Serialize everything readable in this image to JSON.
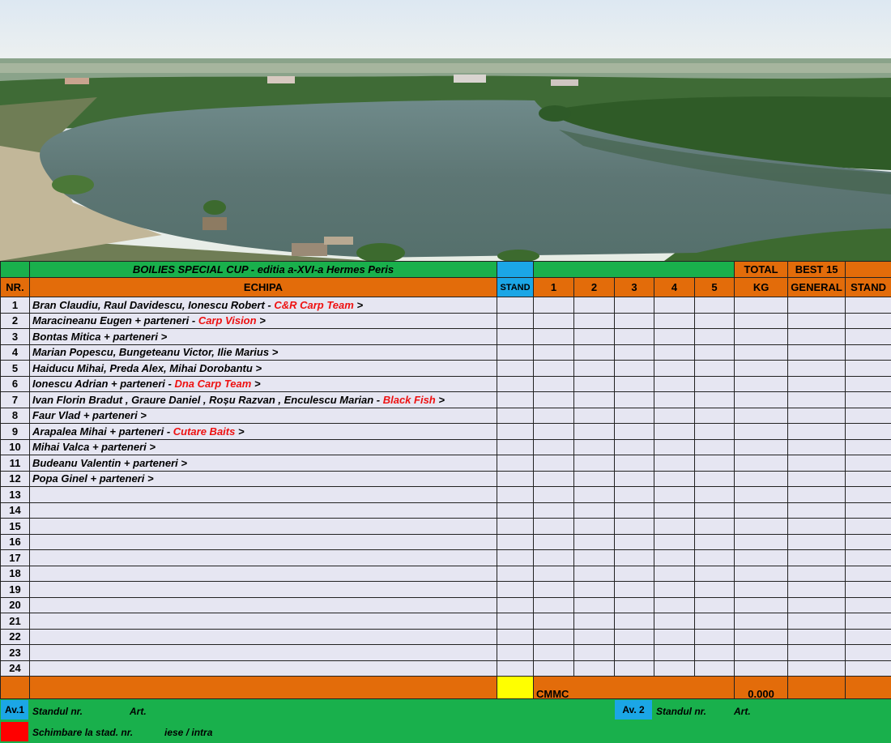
{
  "header": {
    "title": "BOILIES SPECIAL CUP - editia a-XVI-a Hermes Peris",
    "total_label": "TOTAL",
    "kg_label": "KG",
    "best_label": "BEST 15",
    "general_label": "GENERAL",
    "stand_label": "STAND",
    "nr_label": "NR.",
    "echipa_label": "ECHIPA",
    "stand_small_label": "STAND",
    "rounds": [
      "1",
      "2",
      "3",
      "4",
      "5"
    ]
  },
  "rows": [
    {
      "nr": "1",
      "names": "Bran Claudiu, Raul Davidescu, Ionescu Robert - ",
      "team": "C&R Carp Team",
      "tail": " >"
    },
    {
      "nr": "2",
      "names": "Maracineanu Eugen + parteneri - ",
      "team": "Carp Vision",
      "tail": " >"
    },
    {
      "nr": "3",
      "names": "Bontas Mitica + parteneri  >",
      "team": "",
      "tail": ""
    },
    {
      "nr": "4",
      "names": "Marian Popescu, Bungeteanu Victor, Ilie Marius  >",
      "team": "",
      "tail": ""
    },
    {
      "nr": "5",
      "names": "Haiducu Mihai, Preda Alex, Mihai Dorobantu  >",
      "team": "",
      "tail": ""
    },
    {
      "nr": "6",
      "names": "Ionescu Adrian + parteneri - ",
      "team": "Dna Carp Team",
      "tail": "  >"
    },
    {
      "nr": "7",
      "names": "Ivan Florin Bradut , Graure Daniel , Roșu Razvan , Enculescu Marian - ",
      "team": "Black Fish",
      "tail": " >"
    },
    {
      "nr": "8",
      "names": "Faur Vlad + parteneri  >",
      "team": "",
      "tail": ""
    },
    {
      "nr": "9",
      "names": "Arapalea Mihai + parteneri - ",
      "team": "Cutare Baits",
      "tail": "  >"
    },
    {
      "nr": "10",
      "names": "Mihai Valca + parteneri  >",
      "team": "",
      "tail": ""
    },
    {
      "nr": "11",
      "names": "Budeanu Valentin + parteneri  >",
      "team": "",
      "tail": ""
    },
    {
      "nr": "12",
      "names": "Popa Ginel + parteneri  >",
      "team": "",
      "tail": ""
    },
    {
      "nr": "13",
      "names": "",
      "team": "",
      "tail": ""
    },
    {
      "nr": "14",
      "names": "",
      "team": "",
      "tail": ""
    },
    {
      "nr": "15",
      "names": "",
      "team": "",
      "tail": ""
    },
    {
      "nr": "16",
      "names": "",
      "team": "",
      "tail": ""
    },
    {
      "nr": "17",
      "names": "",
      "team": "",
      "tail": ""
    },
    {
      "nr": "18",
      "names": "",
      "team": "",
      "tail": ""
    },
    {
      "nr": "19",
      "names": "",
      "team": "",
      "tail": ""
    },
    {
      "nr": "20",
      "names": "",
      "team": "",
      "tail": ""
    },
    {
      "nr": "21",
      "names": "",
      "team": "",
      "tail": ""
    },
    {
      "nr": "22",
      "names": "",
      "team": "",
      "tail": ""
    },
    {
      "nr": "23",
      "names": "",
      "team": "",
      "tail": ""
    },
    {
      "nr": "24",
      "names": "",
      "team": "",
      "tail": ""
    }
  ],
  "totals": {
    "cmmc_label": "CMMC",
    "total_value": "0.000"
  },
  "legend": {
    "av1_label": "Av.1",
    "standul_label": "Standul nr.",
    "art_label": "Art.",
    "av2_label": "Av. 2",
    "standul2_label": "Standul  nr.",
    "art2_label": "Art.",
    "schimbare_label": "Schimbare la stad.  nr.",
    "iese_label": "iese / intra"
  },
  "colors": {
    "green": "#19b04c",
    "orange": "#e36c0a",
    "blue": "#1ba6e6",
    "lavender": "#e6e6f2",
    "team_red": "#ee1111"
  }
}
